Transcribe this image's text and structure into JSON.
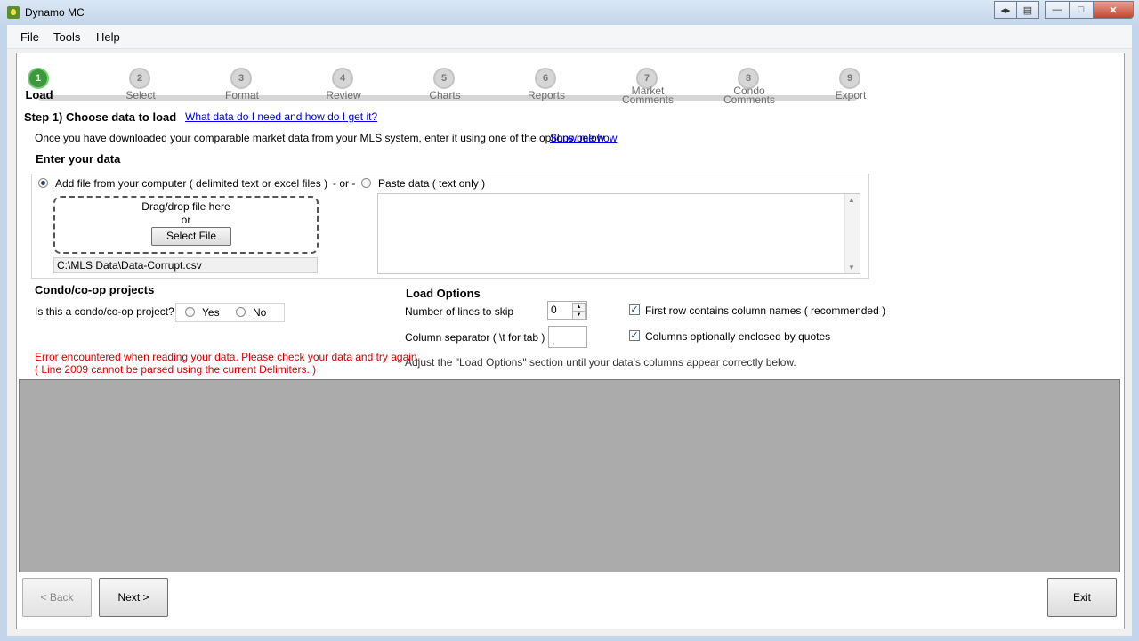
{
  "window": {
    "title": "Dynamo MC"
  },
  "menu": {
    "file": "File",
    "tools": "Tools",
    "help": "Help"
  },
  "steps": [
    {
      "num": "1",
      "label": "Load",
      "label2": ""
    },
    {
      "num": "2",
      "label": "Select",
      "label2": ""
    },
    {
      "num": "3",
      "label": "Format",
      "label2": ""
    },
    {
      "num": "4",
      "label": "Review",
      "label2": ""
    },
    {
      "num": "5",
      "label": "Charts",
      "label2": ""
    },
    {
      "num": "6",
      "label": "Reports",
      "label2": ""
    },
    {
      "num": "7",
      "label": "Market",
      "label2": "Comments"
    },
    {
      "num": "8",
      "label": "Condo",
      "label2": "Comments"
    },
    {
      "num": "9",
      "label": "Export",
      "label2": ""
    }
  ],
  "step_header": {
    "title": "Step 1) Choose data to load",
    "help_link": "What data do I need and how do I get it?"
  },
  "intro": {
    "text": "Once you have downloaded your comparable market data from your MLS system, enter it using one of the options below",
    "link": "Show me how"
  },
  "enter_data": {
    "heading": "Enter your data",
    "add_file_label": "Add file from your computer ( delimited text or excel files )",
    "or_separator": "- or -",
    "paste_label": "Paste data ( text only )",
    "drop_text": "Drag/drop file here",
    "drop_or": "or",
    "select_file_button": "Select File",
    "file_path": "C:\\MLS Data\\Data-Corrupt.csv"
  },
  "condo": {
    "heading": "Condo/co-op projects",
    "question": "Is this a condo/co-op project?",
    "yes": "Yes",
    "no": "No"
  },
  "load_options": {
    "heading": "Load Options",
    "lines_to_skip_label": "Number of lines to skip",
    "lines_to_skip_value": "0",
    "separator_label": "Column separator ( \\t for tab )",
    "separator_value": ",",
    "first_row_label": "First row contains column names ( recommended )",
    "quotes_label": "Columns optionally enclosed by quotes",
    "hint": "Adjust the \"Load Options\" section until your data's columns appear correctly below."
  },
  "error": {
    "line1": "Error encountered when reading your data. Please check your data and try again.",
    "line2": "( Line 2009 cannot be parsed using the current Delimiters. )"
  },
  "footer": {
    "back": "< Back",
    "next": "Next >",
    "exit": "Exit"
  }
}
